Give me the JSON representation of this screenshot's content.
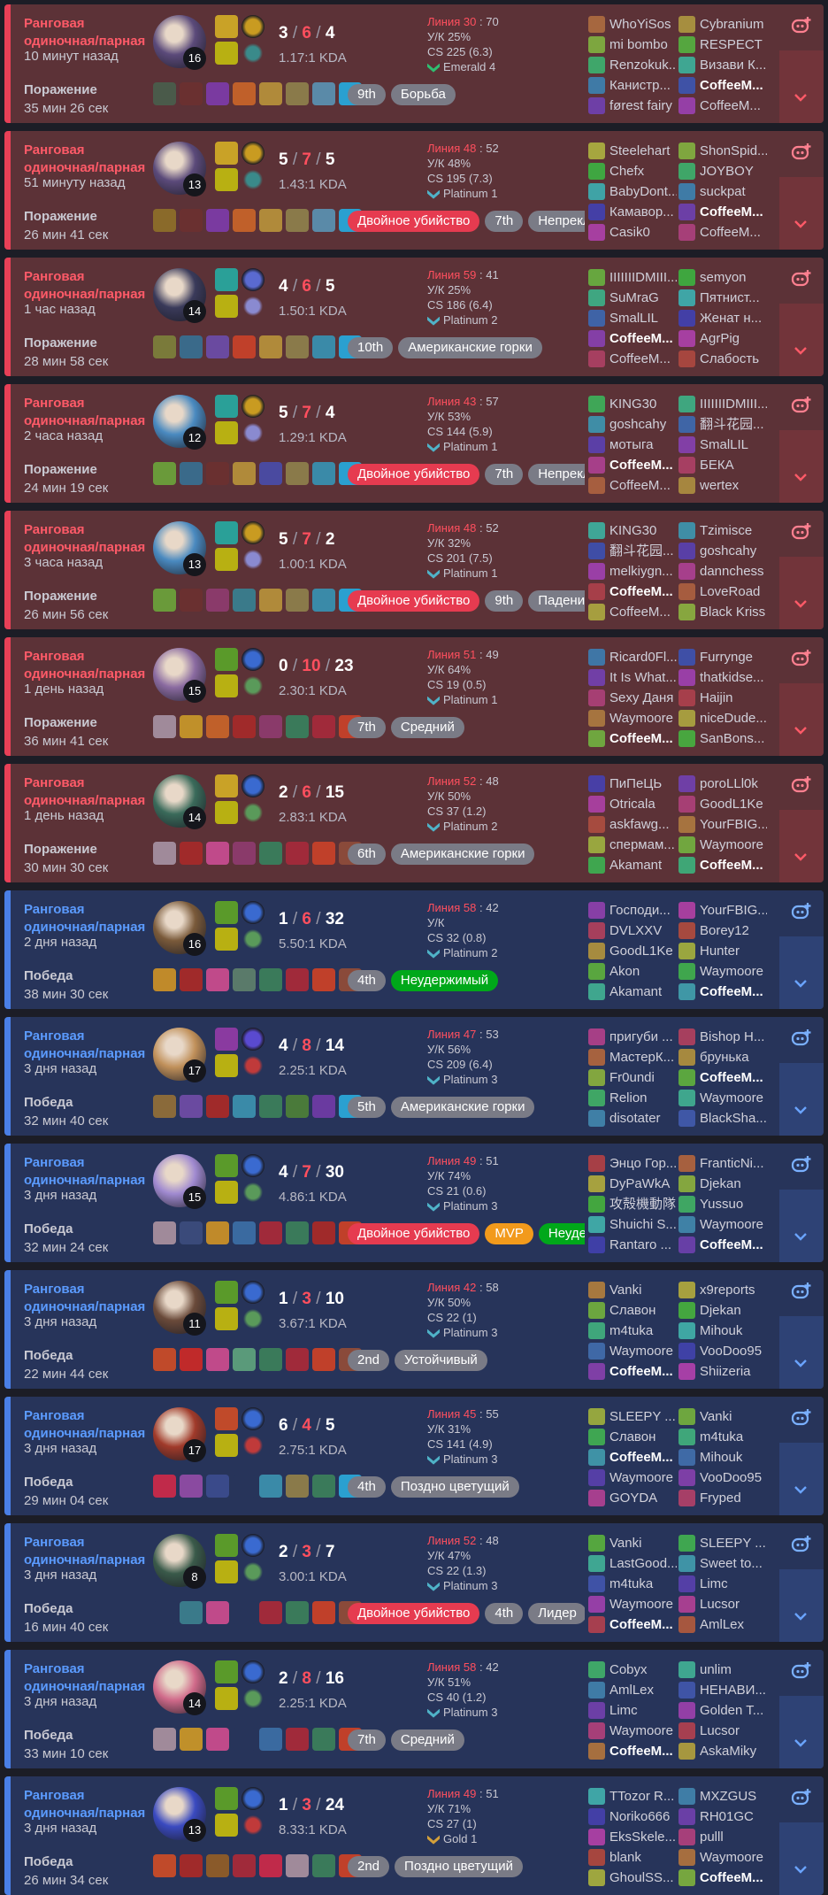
{
  "colors": {
    "loss_bg": "#5c3237",
    "win_bg": "#27345a",
    "loss_accent": "#e84057",
    "win_accent": "#4a7fe6",
    "death": "#ff4f5e",
    "tag_red": "#e63b50",
    "tag_green": "#00a81a",
    "tag_orange": "#f29a1c",
    "tag_gray": "#7a7b86"
  },
  "labels": {
    "lane": "Линия",
    "kp": "У/К",
    "cs": "CS",
    "kda_suffix": "KDA"
  },
  "icons": {
    "add_favorite": "add-friend-icon",
    "expand": "chevron-down-icon",
    "tier": "tier-wings-icon"
  },
  "matches": [
    {
      "result": "loss",
      "queue": "Ранговая одиночная/парная",
      "ago": "10 минут назад",
      "outcome": "Поражение",
      "duration": "35 мин 26 сек",
      "level": "16",
      "champ_color": "#5b4a7a",
      "spells": [
        "#c9a227",
        "#b8b012"
      ],
      "runes": [
        "#c99b21",
        "#3a8a8a"
      ],
      "k": "3",
      "d": "6",
      "a": "4",
      "ratio": "1.17:1 KDA",
      "lane_a": "30",
      "lane_b": "70",
      "kp": "25%",
      "cs": "225 (6.3)",
      "tier": "Emerald 4",
      "tier_color": "#2fbf71",
      "items": [
        "#4a5a4a",
        "#6a3030",
        "#7a3aa0",
        "#c0602a",
        "#b08a3a",
        "#8a7a4a",
        "#5a8aa8",
        "#2aa0d0"
      ],
      "tags": [
        {
          "t": "9th",
          "c": "gray"
        },
        {
          "t": "Борьба",
          "c": "gray"
        }
      ],
      "team1": [
        "WhoYiSos",
        "mi bombo",
        "Renzokuk...",
        "Канистр...",
        "førest fairy"
      ],
      "team2": [
        "Cybranium",
        "RESPECT",
        "Визави К...",
        "CoffeeM...",
        "CoffeeM..."
      ],
      "me_team": 2,
      "me_idx": 3
    },
    {
      "result": "loss",
      "queue": "Ранговая одиночная/парная",
      "ago": "51 минуту назад",
      "outcome": "Поражение",
      "duration": "26 мин 41 сек",
      "level": "13",
      "champ_color": "#5b4a7a",
      "spells": [
        "#c9a227",
        "#b8b012"
      ],
      "runes": [
        "#c99b21",
        "#3a8a8a"
      ],
      "k": "5",
      "d": "7",
      "a": "5",
      "ratio": "1.43:1 KDA",
      "lane_a": "48",
      "lane_b": "52",
      "kp": "48%",
      "cs": "195 (7.3)",
      "tier": "Platinum 1",
      "tier_color": "#4fb3c8",
      "items": [
        "#8a6a2a",
        "#6a3030",
        "#7a3aa0",
        "#c0602a",
        "#b08a3a",
        "#8a7a4a",
        "#5a8aa8",
        "#2aa0d0"
      ],
      "tags": [
        {
          "t": "Двойное убийство",
          "c": "red"
        },
        {
          "t": "7th",
          "c": "gray"
        },
        {
          "t": "Непреклонный",
          "c": "gray"
        }
      ],
      "team1": [
        "Steelehart",
        "Chefx",
        "BabyDont...",
        "Камавор...",
        "Casik0"
      ],
      "team2": [
        "ShonSpid...",
        "JOYBOY",
        "suckpat",
        "CoffeeM...",
        "CoffeeM..."
      ],
      "me_team": 2,
      "me_idx": 3
    },
    {
      "result": "loss",
      "queue": "Ранговая одиночная/парная",
      "ago": "1 час назад",
      "outcome": "Поражение",
      "duration": "28 мин 58 сек",
      "level": "14",
      "champ_color": "#3a3a5a",
      "spells": [
        "#2aa098",
        "#b8b012"
      ],
      "runes": [
        "#5a6ad0",
        "#8a8ad0"
      ],
      "k": "4",
      "d": "6",
      "a": "5",
      "ratio": "1.50:1 KDA",
      "lane_a": "59",
      "lane_b": "41",
      "kp": "25%",
      "cs": "186 (6.4)",
      "tier": "Platinum 2",
      "tier_color": "#4fb3c8",
      "items": [
        "#7a7a3a",
        "#3a6a8a",
        "#6a4aa0",
        "#c0402a",
        "#b08a3a",
        "#8a7a4a",
        "#3a8aa8",
        "#2aa0d0"
      ],
      "tags": [
        {
          "t": "10th",
          "c": "gray"
        },
        {
          "t": "Американские горки",
          "c": "gray"
        }
      ],
      "team1": [
        "IIIIIIIDMIII...",
        "SuMraG",
        "SmalLIL",
        "CoffeeM...",
        "CoffeeM..."
      ],
      "team2": [
        "semyon",
        "Пятнист...",
        "Женат н...",
        "AgrPig",
        "Слабость"
      ],
      "me_team": 1,
      "me_idx": 3
    },
    {
      "result": "loss",
      "queue": "Ранговая одиночная/парная",
      "ago": "2 часа назад",
      "outcome": "Поражение",
      "duration": "24 мин 19 сек",
      "level": "12",
      "champ_color": "#4a8ac0",
      "spells": [
        "#2aa098",
        "#b8b012"
      ],
      "runes": [
        "#c99b21",
        "#8a8ad0"
      ],
      "k": "5",
      "d": "7",
      "a": "4",
      "ratio": "1.29:1 KDA",
      "lane_a": "43",
      "lane_b": "57",
      "kp": "53%",
      "cs": "144 (5.9)",
      "tier": "Platinum 1",
      "tier_color": "#4fb3c8",
      "items": [
        "#6a9a3a",
        "#3a6a8a",
        "#6a3030",
        "#b08a3a",
        "#4a4aa0",
        "#8a7a4a",
        "#3a8aa8",
        "#2aa0d0"
      ],
      "tags": [
        {
          "t": "Двойное убийство",
          "c": "red"
        },
        {
          "t": "7th",
          "c": "gray"
        },
        {
          "t": "Непреклонный",
          "c": "gray"
        }
      ],
      "team1": [
        "KING30",
        "goshcahy",
        "мотыга",
        "CoffeeM...",
        "CoffeeM..."
      ],
      "team2": [
        "IIIIIIIDMIII...",
        "翻斗花园...",
        "SmalLIL",
        "БЕКА",
        "wertex"
      ],
      "me_team": 1,
      "me_idx": 3
    },
    {
      "result": "loss",
      "queue": "Ранговая одиночная/парная",
      "ago": "3 часа назад",
      "outcome": "Поражение",
      "duration": "26 мин 56 сек",
      "level": "13",
      "champ_color": "#4a8ac0",
      "spells": [
        "#2aa098",
        "#b8b012"
      ],
      "runes": [
        "#c99b21",
        "#8a8ad0"
      ],
      "k": "5",
      "d": "7",
      "a": "2",
      "ratio": "1.00:1 KDA",
      "lane_a": "48",
      "lane_b": "52",
      "kp": "32%",
      "cs": "201 (7.5)",
      "tier": "Platinum 1",
      "tier_color": "#4fb3c8",
      "items": [
        "#6a9a3a",
        "#6a3030",
        "#8a3a6a",
        "#3a7a8a",
        "#b08a3a",
        "#8a7a4a",
        "#3a8aa8",
        "#2aa0d0"
      ],
      "tags": [
        {
          "t": "Двойное убийство",
          "c": "red"
        },
        {
          "t": "9th",
          "c": "gray"
        },
        {
          "t": "Падение",
          "c": "gray"
        }
      ],
      "team1": [
        "KING30",
        "翻斗花园...",
        "melkiygn...",
        "CoffeeM...",
        "CoffeeM..."
      ],
      "team2": [
        "Tzimisce",
        "goshcahy",
        "dannchess",
        "LoveRoad",
        "Black Kriss"
      ],
      "me_team": 1,
      "me_idx": 3
    },
    {
      "result": "loss",
      "queue": "Ранговая одиночная/парная",
      "ago": "1 день назад",
      "outcome": "Поражение",
      "duration": "36 мин 41 сек",
      "level": "15",
      "champ_color": "#8a6aa0",
      "spells": [
        "#5a9a2a",
        "#b8b012"
      ],
      "runes": [
        "#3a6ad0",
        "#5a9a5a"
      ],
      "k": "0",
      "d": "10",
      "a": "23",
      "ratio": "2.30:1 KDA",
      "lane_a": "51",
      "lane_b": "49",
      "kp": "64%",
      "cs": "19 (0.5)",
      "tier": "Platinum 1",
      "tier_color": "#4fb3c8",
      "items": [
        "#a08a9a",
        "#c0902a",
        "#c0602a",
        "#a02a2a",
        "#8a3a6a",
        "#3a7a5a",
        "#a02a3a",
        "#c0402a"
      ],
      "tags": [
        {
          "t": "7th",
          "c": "gray"
        },
        {
          "t": "Средний",
          "c": "gray"
        }
      ],
      "team1": [
        "Ricard0Fl...",
        "It Is What...",
        "Sexy Даня",
        "Waymoore",
        "CoffeeM..."
      ],
      "team2": [
        "Furrynge",
        "thatkidse...",
        "Haijin",
        "niceDude...",
        "SanBons..."
      ],
      "me_team": 1,
      "me_idx": 4
    },
    {
      "result": "loss",
      "queue": "Ранговая одиночная/парная",
      "ago": "1 день назад",
      "outcome": "Поражение",
      "duration": "30 мин 30 сек",
      "level": "14",
      "champ_color": "#3a6a5a",
      "spells": [
        "#c9a227",
        "#b8b012"
      ],
      "runes": [
        "#3a6ad0",
        "#5a9a5a"
      ],
      "k": "2",
      "d": "6",
      "a": "15",
      "ratio": "2.83:1 KDA",
      "lane_a": "52",
      "lane_b": "48",
      "kp": "50%",
      "cs": "37 (1.2)",
      "tier": "Platinum 2",
      "tier_color": "#4fb3c8",
      "items": [
        "#a08a9a",
        "#a02a2a",
        "#c04a8a",
        "#8a3a6a",
        "#3a7a5a",
        "#a02a3a",
        "#c0402a",
        "#8a4a3a"
      ],
      "tags": [
        {
          "t": "6th",
          "c": "gray"
        },
        {
          "t": "Американские горки",
          "c": "gray"
        }
      ],
      "team1": [
        "ПиПеЦЬ",
        "Otricala",
        "askfawg...",
        "спермам...",
        "Akamant"
      ],
      "team2": [
        "poroLLl0k",
        "GoodL1Ke",
        "YourFBIG...",
        "Waymoore",
        "CoffeeM..."
      ],
      "me_team": 2,
      "me_idx": 4
    },
    {
      "result": "win",
      "queue": "Ранговая одиночная/парная",
      "ago": "2 дня назад",
      "outcome": "Победа",
      "duration": "38 мин 30 сек",
      "level": "16",
      "champ_color": "#7a5a3a",
      "spells": [
        "#5a9a2a",
        "#b8b012"
      ],
      "runes": [
        "#3a6ad0",
        "#5a9a5a"
      ],
      "k": "1",
      "d": "6",
      "a": "32",
      "ratio": "5.50:1 KDA",
      "lane_a": "58",
      "lane_b": "42",
      "kp": "",
      "cs": "32 (0.8)",
      "tier": "Platinum 2",
      "tier_color": "#4fb3c8",
      "items": [
        "#c08a2a",
        "#a02a2a",
        "#c04a8a",
        "#5a7a6a",
        "#3a7a5a",
        "#a02a3a",
        "#c0402a",
        "#8a4a3a"
      ],
      "tags": [
        {
          "t": "4th",
          "c": "gray"
        },
        {
          "t": "Неудержимый",
          "c": "green"
        }
      ],
      "team1": [
        "Господи...",
        "DVLXXV",
        "GoodL1Ke",
        "Akon",
        "Akamant"
      ],
      "team2": [
        "YourFBIG...",
        "Borey12",
        "Hunter",
        "Waymoore",
        "CoffeeM..."
      ],
      "me_team": 2,
      "me_idx": 4
    },
    {
      "result": "win",
      "queue": "Ранговая одиночная/парная",
      "ago": "3 дня назад",
      "outcome": "Победа",
      "duration": "32 мин 40 сек",
      "level": "17",
      "champ_color": "#c0905a",
      "spells": [
        "#8a3aa0",
        "#b8b012"
      ],
      "runes": [
        "#5a4ad0",
        "#c03a3a"
      ],
      "k": "4",
      "d": "8",
      "a": "14",
      "ratio": "2.25:1 KDA",
      "lane_a": "47",
      "lane_b": "53",
      "kp": "56%",
      "cs": "209 (6.4)",
      "tier": "Platinum 3",
      "tier_color": "#4fb3c8",
      "items": [
        "#8a6a3a",
        "#6a4aa0",
        "#a02a2a",
        "#3a8aa8",
        "#3a7a5a",
        "#4a7a3a",
        "#6a3aa0",
        "#2aa0d0"
      ],
      "tags": [
        {
          "t": "5th",
          "c": "gray"
        },
        {
          "t": "Американские горки",
          "c": "gray"
        }
      ],
      "team1": [
        "пригуби ...",
        "МастерК...",
        "Fr0undi",
        "Relion",
        "disotater"
      ],
      "team2": [
        "Bishop H...",
        "брунька",
        "CoffeeM...",
        "Waymoore",
        "BlackSha..."
      ],
      "me_team": 2,
      "me_idx": 2
    },
    {
      "result": "win",
      "queue": "Ранговая одиночная/парная",
      "ago": "3 дня назад",
      "outcome": "Победа",
      "duration": "32 мин 24 сек",
      "level": "15",
      "champ_color": "#a08ad0",
      "spells": [
        "#5a9a2a",
        "#b8b012"
      ],
      "runes": [
        "#3a6ad0",
        "#5a9a5a"
      ],
      "k": "4",
      "d": "7",
      "a": "30",
      "ratio": "4.86:1 KDA",
      "lane_a": "49",
      "lane_b": "51",
      "kp": "74%",
      "cs": "21 (0.6)",
      "tier": "Platinum 3",
      "tier_color": "#4fb3c8",
      "items": [
        "#a08a9a",
        "#3a4a7a",
        "#c08a2a",
        "#3a6aa0",
        "#a02a3a",
        "#3a7a5a",
        "#a02a2a",
        "#c0402a"
      ],
      "tags": [
        {
          "t": "Двойное убийство",
          "c": "red"
        },
        {
          "t": "MVP",
          "c": "orange"
        },
        {
          "t": "Неудержимый",
          "c": "green"
        }
      ],
      "team1": [
        "Энцо Гор...",
        "DyPaWkA",
        "攻殻機動隊",
        "Shuichi S...",
        "Rantaro ..."
      ],
      "team2": [
        "FranticNi...",
        "Djekan",
        "Yussuo",
        "Waymoore",
        "CoffeeM..."
      ],
      "me_team": 2,
      "me_idx": 4
    },
    {
      "result": "win",
      "queue": "Ранговая одиночная/парная",
      "ago": "3 дня назад",
      "outcome": "Победа",
      "duration": "22 мин 44 сек",
      "level": "11",
      "champ_color": "#6a4a3a",
      "spells": [
        "#5a9a2a",
        "#b8b012"
      ],
      "runes": [
        "#3a6ad0",
        "#5a9a5a"
      ],
      "k": "1",
      "d": "3",
      "a": "10",
      "ratio": "3.67:1 KDA",
      "lane_a": "42",
      "lane_b": "58",
      "kp": "50%",
      "cs": "22 (1)",
      "tier": "Platinum 3",
      "tier_color": "#4fb3c8",
      "items": [
        "#c04a2a",
        "#c02a2a",
        "#c04a8a",
        "#5a9a7a",
        "#3a7a5a",
        "#a02a3a",
        "#c0402a",
        "#8a4a3a"
      ],
      "tags": [
        {
          "t": "2nd",
          "c": "gray"
        },
        {
          "t": "Устойчивый",
          "c": "gray"
        }
      ],
      "team1": [
        "Vanki",
        "Славон",
        "m4tuka",
        "Waymoore",
        "CoffeeM..."
      ],
      "team2": [
        "x9reports",
        "Djekan",
        "Mihouk",
        "VooDoo95",
        "Shiizeria"
      ],
      "me_team": 1,
      "me_idx": 4
    },
    {
      "result": "win",
      "queue": "Ранговая одиночная/парная",
      "ago": "3 дня назад",
      "outcome": "Победа",
      "duration": "29 мин 04 сек",
      "level": "17",
      "champ_color": "#a03a2a",
      "spells": [
        "#c04a2a",
        "#b8b012"
      ],
      "runes": [
        "#3a6ad0",
        "#c03a3a"
      ],
      "k": "6",
      "d": "4",
      "a": "5",
      "ratio": "2.75:1 KDA",
      "lane_a": "45",
      "lane_b": "55",
      "kp": "31%",
      "cs": "141 (4.9)",
      "tier": "Platinum 3",
      "tier_color": "#4fb3c8",
      "items": [
        "#c02a4a",
        "#8a4aa0",
        "#3a4a8a",
        "#27345a",
        "#3a8aa8",
        "#8a7a4a",
        "#3a7a5a",
        "#2aa0d0"
      ],
      "tags": [
        {
          "t": "4th",
          "c": "gray"
        },
        {
          "t": "Поздно цветущий",
          "c": "gray"
        }
      ],
      "team1": [
        "SLEEPY ...",
        "Славон",
        "CoffeeM...",
        "Waymoore",
        "GOYDA"
      ],
      "team2": [
        "Vanki",
        "m4tuka",
        "Mihouk",
        "VooDoo95",
        "Fryped"
      ],
      "me_team": 1,
      "me_idx": 2
    },
    {
      "result": "win",
      "queue": "Ранговая одиночная/парная",
      "ago": "3 дня назад",
      "outcome": "Победа",
      "duration": "16 мин 40 сек",
      "level": "8",
      "champ_color": "#3a5a4a",
      "spells": [
        "#5a9a2a",
        "#b8b012"
      ],
      "runes": [
        "#3a6ad0",
        "#5a9a5a"
      ],
      "k": "2",
      "d": "3",
      "a": "7",
      "ratio": "3.00:1 KDA",
      "lane_a": "52",
      "lane_b": "48",
      "kp": "47%",
      "cs": "22 (1.3)",
      "tier": "Platinum 3",
      "tier_color": "#4fb3c8",
      "items": [
        "#27345a",
        "#3a7a8a",
        "#c04a8a",
        "#27345a",
        "#a02a3a",
        "#3a7a5a",
        "#c0402a",
        "#8a4a3a"
      ],
      "tags": [
        {
          "t": "Двойное убийство",
          "c": "red"
        },
        {
          "t": "4th",
          "c": "gray"
        },
        {
          "t": "Лидер",
          "c": "gray"
        }
      ],
      "team1": [
        "Vanki",
        "LastGood...",
        "m4tuka",
        "Waymoore",
        "CoffeeM..."
      ],
      "team2": [
        "SLEEPY ...",
        "Sweet to...",
        "Limc",
        "Lucsor",
        "AmlLex"
      ],
      "me_team": 1,
      "me_idx": 4
    },
    {
      "result": "win",
      "queue": "Ранговая одиночная/парная",
      "ago": "3 дня назад",
      "outcome": "Победа",
      "duration": "33 мин 10 сек",
      "level": "14",
      "champ_color": "#d06a8a",
      "spells": [
        "#5a9a2a",
        "#b8b012"
      ],
      "runes": [
        "#3a6ad0",
        "#5a9a5a"
      ],
      "k": "2",
      "d": "8",
      "a": "16",
      "ratio": "2.25:1 KDA",
      "lane_a": "58",
      "lane_b": "42",
      "kp": "51%",
      "cs": "40 (1.2)",
      "tier": "Platinum 3",
      "tier_color": "#4fb3c8",
      "items": [
        "#a08a9a",
        "#c0902a",
        "#c04a8a",
        "#27345a",
        "#3a6aa0",
        "#a02a3a",
        "#3a7a5a",
        "#c0402a"
      ],
      "tags": [
        {
          "t": "7th",
          "c": "gray"
        },
        {
          "t": "Средний",
          "c": "gray"
        }
      ],
      "team1": [
        "Cobyx",
        "AmlLex",
        "Limc",
        "Waymoore",
        "CoffeeM..."
      ],
      "team2": [
        "unlim",
        "НЕНАВИ...",
        "Golden T...",
        "Lucsor",
        "AskaMiky"
      ],
      "me_team": 1,
      "me_idx": 4
    },
    {
      "result": "win",
      "queue": "Ранговая одиночная/парная",
      "ago": "3 дня назад",
      "outcome": "Победа",
      "duration": "26 мин 34 сек",
      "level": "13",
      "champ_color": "#3a4ac0",
      "spells": [
        "#5a9a2a",
        "#b8b012"
      ],
      "runes": [
        "#3a6ad0",
        "#c03a3a"
      ],
      "k": "1",
      "d": "3",
      "a": "24",
      "ratio": "8.33:1 KDA",
      "lane_a": "49",
      "lane_b": "51",
      "kp": "71%",
      "cs": "27 (1)",
      "tier": "Gold 1",
      "tier_color": "#d4a03a",
      "items": [
        "#c04a2a",
        "#a02a2a",
        "#8a5a2a",
        "#a02a3a",
        "#c02a4a",
        "#a08a9a",
        "#3a7a5a",
        "#c0402a"
      ],
      "tags": [
        {
          "t": "2nd",
          "c": "gray"
        },
        {
          "t": "Поздно цветущий",
          "c": "gray"
        }
      ],
      "team1": [
        "TTozor R...",
        "Noriko666",
        "EksSkele...",
        "blank",
        "GhoulSS..."
      ],
      "team2": [
        "MXZGUS",
        "RH01GC",
        "pulll",
        "Waymoore",
        "CoffeeM..."
      ],
      "me_team": 2,
      "me_idx": 4
    }
  ]
}
